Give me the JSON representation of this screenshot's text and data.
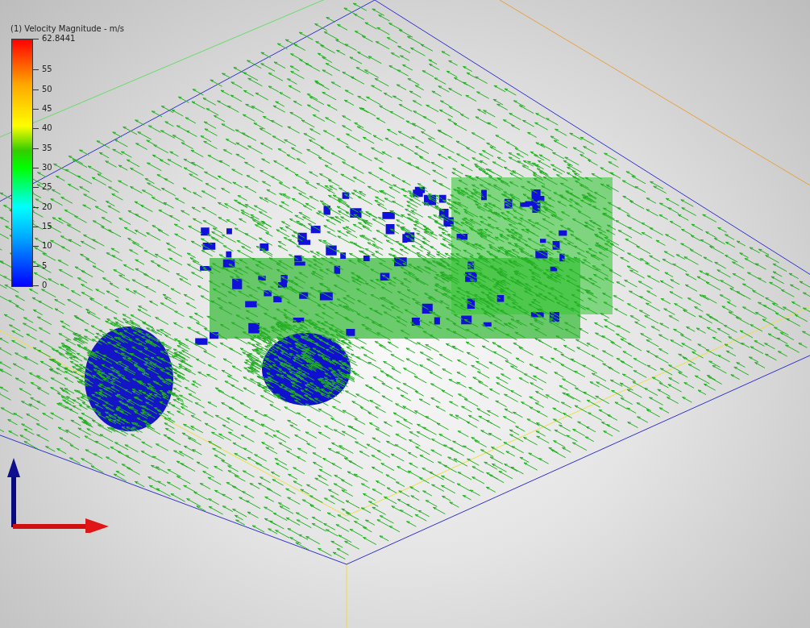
{
  "legend": {
    "title": "(1) Velocity Magnitude - m/s",
    "max_label": "62.8441",
    "ticks": [
      "55",
      "50",
      "45",
      "40",
      "35",
      "30",
      "25",
      "20",
      "15",
      "10",
      "5",
      "0"
    ]
  }
}
